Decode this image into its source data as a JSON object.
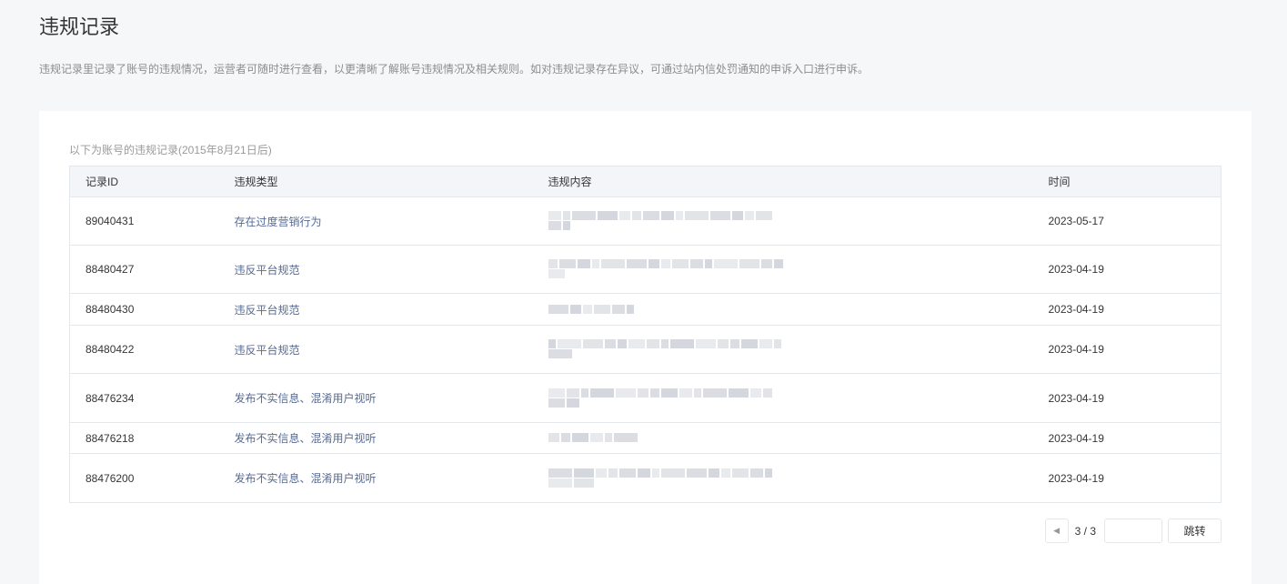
{
  "page": {
    "title": "违规记录",
    "description": "违规记录里记录了账号的违规情况，运营者可随时进行查看，以更清晰了解账号违规情况及相关规则。如对违规记录存在异议，可通过站内信处罚通知的申诉入口进行申诉。"
  },
  "table": {
    "caption": "以下为账号的违规记录(2015年8月21日后)",
    "headers": [
      "记录ID",
      "违规类型",
      "违规内容",
      "时间"
    ],
    "rows": [
      {
        "id": "89040431",
        "type": "存在过度营销行为",
        "time": "2023-05-17"
      },
      {
        "id": "88480427",
        "type": "违反平台规范",
        "time": "2023-04-19"
      },
      {
        "id": "88480430",
        "type": "违反平台规范",
        "time": "2023-04-19"
      },
      {
        "id": "88480422",
        "type": "违反平台规范",
        "time": "2023-04-19"
      },
      {
        "id": "88476234",
        "type": "发布不实信息、混淆用户视听",
        "time": "2023-04-19"
      },
      {
        "id": "88476218",
        "type": "发布不实信息、混淆用户视听",
        "time": "2023-04-19"
      },
      {
        "id": "88476200",
        "type": "发布不实信息、混淆用户视听",
        "time": "2023-04-19"
      }
    ]
  },
  "pager": {
    "current": "3 / 3",
    "jump_label": "跳转",
    "prev_icon": "triangle-left-icon"
  }
}
